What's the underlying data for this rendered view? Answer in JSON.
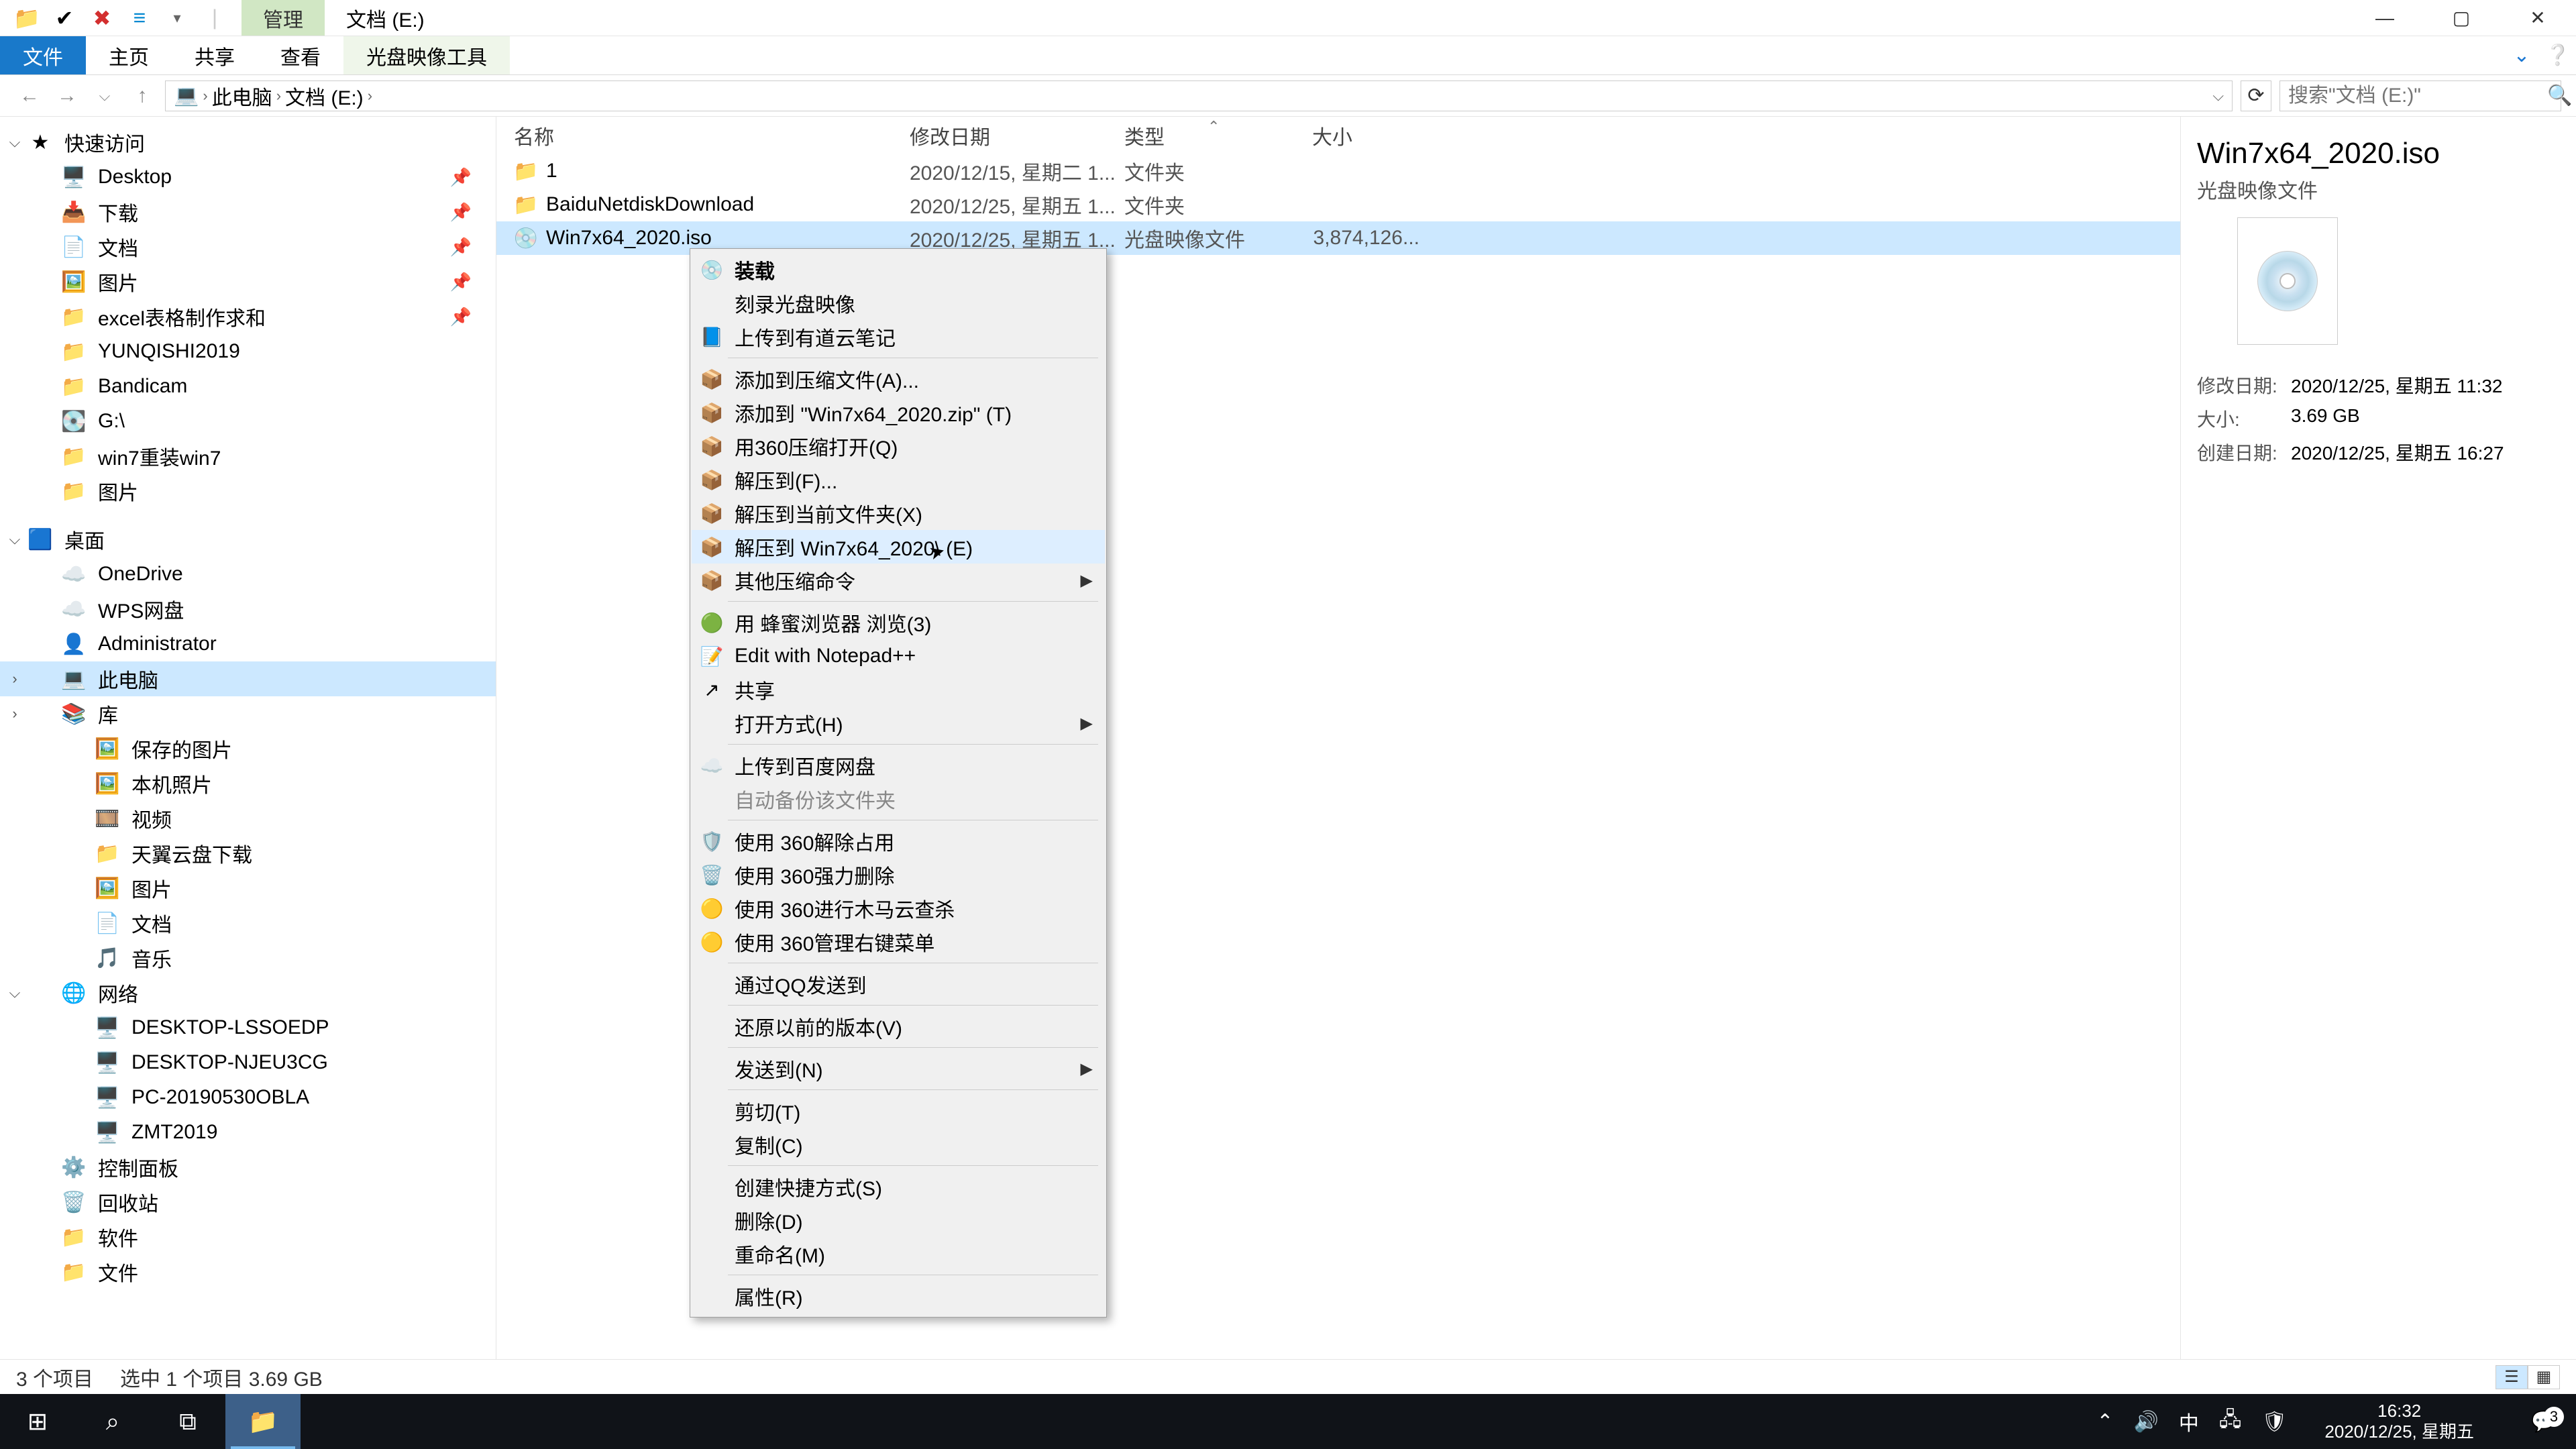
{
  "titlebar": {
    "context_tab": "管理",
    "location_tab": "文档 (E:)"
  },
  "ribbon": {
    "tabs": [
      "文件",
      "主页",
      "共享",
      "查看",
      "光盘映像工具"
    ]
  },
  "breadcrumb": {
    "segments": [
      "此电脑",
      "文档 (E:)"
    ]
  },
  "search": {
    "placeholder": "搜索\"文档 (E:)\""
  },
  "nav": {
    "quick_access": "快速访问",
    "items_qa": [
      {
        "label": "Desktop",
        "icon": "🖥️",
        "pin": true
      },
      {
        "label": "下载",
        "icon": "📥",
        "pin": true
      },
      {
        "label": "文档",
        "icon": "📄",
        "pin": true
      },
      {
        "label": "图片",
        "icon": "🖼️",
        "pin": true
      },
      {
        "label": "excel表格制作求和",
        "icon": "📁",
        "pin": true
      },
      {
        "label": "YUNQISHI2019",
        "icon": "📁",
        "pin": false
      },
      {
        "label": "Bandicam",
        "icon": "📁",
        "pin": false
      },
      {
        "label": "G:\\",
        "icon": "💽",
        "pin": false
      },
      {
        "label": "win7重装win7",
        "icon": "📁",
        "pin": false
      },
      {
        "label": "图片",
        "icon": "📁",
        "pin": false
      }
    ],
    "desktop": "桌面",
    "items_desktop": [
      {
        "label": "OneDrive",
        "icon": "☁️"
      },
      {
        "label": "WPS网盘",
        "icon": "☁️"
      },
      {
        "label": "Administrator",
        "icon": "👤"
      },
      {
        "label": "此电脑",
        "icon": "💻",
        "selected": true
      },
      {
        "label": "库",
        "icon": "📚"
      }
    ],
    "items_lib": [
      {
        "label": "保存的图片",
        "icon": "🖼️"
      },
      {
        "label": "本机照片",
        "icon": "🖼️"
      },
      {
        "label": "视频",
        "icon": "🎞️"
      },
      {
        "label": "天翼云盘下载",
        "icon": "📁"
      },
      {
        "label": "图片",
        "icon": "🖼️"
      },
      {
        "label": "文档",
        "icon": "📄"
      },
      {
        "label": "音乐",
        "icon": "🎵"
      }
    ],
    "network": "网络",
    "items_net": [
      {
        "label": "DESKTOP-LSSOEDP",
        "icon": "🖥️"
      },
      {
        "label": "DESKTOP-NJEU3CG",
        "icon": "🖥️"
      },
      {
        "label": "PC-20190530OBLA",
        "icon": "🖥️"
      },
      {
        "label": "ZMT2019",
        "icon": "🖥️"
      }
    ],
    "items_bottom": [
      {
        "label": "控制面板",
        "icon": "⚙️"
      },
      {
        "label": "回收站",
        "icon": "🗑️"
      },
      {
        "label": "软件",
        "icon": "📁"
      },
      {
        "label": "文件",
        "icon": "📁"
      }
    ]
  },
  "columns": {
    "name": "名称",
    "date": "修改日期",
    "type": "类型",
    "size": "大小"
  },
  "rows": [
    {
      "name": "1",
      "date": "2020/12/15, 星期二 1...",
      "type": "文件夹",
      "size": "",
      "icon": "📁",
      "cls": "folder-ico"
    },
    {
      "name": "BaiduNetdiskDownload",
      "date": "2020/12/25, 星期五 1...",
      "type": "文件夹",
      "size": "",
      "icon": "📁",
      "cls": "folder-ico"
    },
    {
      "name": "Win7x64_2020.iso",
      "date": "2020/12/25, 星期五 1...",
      "type": "光盘映像文件",
      "size": "3,874,126...",
      "icon": "💿",
      "cls": "iso-ico",
      "selected": true
    }
  ],
  "details": {
    "title": "Win7x64_2020.iso",
    "type": "光盘映像文件",
    "props": [
      {
        "k": "修改日期:",
        "v": "2020/12/25, 星期五 11:32"
      },
      {
        "k": "大小:",
        "v": "3.69 GB"
      },
      {
        "k": "创建日期:",
        "v": "2020/12/25, 星期五 16:27"
      }
    ]
  },
  "ctx": [
    {
      "label": "装载",
      "bold": true,
      "icon": "💿"
    },
    {
      "label": "刻录光盘映像"
    },
    {
      "label": "上传到有道云笔记",
      "icon": "📘",
      "icls": "blue-ico"
    },
    {
      "sep": true
    },
    {
      "label": "添加到压缩文件(A)...",
      "icon": "📦"
    },
    {
      "label": "添加到 \"Win7x64_2020.zip\" (T)",
      "icon": "📦"
    },
    {
      "label": "用360压缩打开(Q)",
      "icon": "📦"
    },
    {
      "label": "解压到(F)...",
      "icon": "📦"
    },
    {
      "label": "解压到当前文件夹(X)",
      "icon": "📦"
    },
    {
      "label": "解压到 Win7x64_2020\\ (E)",
      "icon": "📦",
      "hover": true
    },
    {
      "label": "其他压缩命令",
      "icon": "📦",
      "sub": true
    },
    {
      "sep": true
    },
    {
      "label": "用 蜂蜜浏览器 浏览(3)",
      "icon": "🟢",
      "icls": "green-ico"
    },
    {
      "label": "Edit with Notepad++",
      "icon": "📝"
    },
    {
      "label": "共享",
      "icon": "↗"
    },
    {
      "label": "打开方式(H)",
      "sub": true
    },
    {
      "sep": true
    },
    {
      "label": "上传到百度网盘",
      "icon": "☁️"
    },
    {
      "label": "自动备份该文件夹",
      "disabled": true
    },
    {
      "sep": true
    },
    {
      "label": "使用 360解除占用",
      "icon": "🛡️"
    },
    {
      "label": "使用 360强力删除",
      "icon": "🗑️"
    },
    {
      "label": "使用 360进行木马云查杀",
      "icon": "🟡"
    },
    {
      "label": "使用 360管理右键菜单",
      "icon": "🟡"
    },
    {
      "sep": true
    },
    {
      "label": "通过QQ发送到"
    },
    {
      "sep": true
    },
    {
      "label": "还原以前的版本(V)"
    },
    {
      "sep": true
    },
    {
      "label": "发送到(N)",
      "sub": true
    },
    {
      "sep": true
    },
    {
      "label": "剪切(T)"
    },
    {
      "label": "复制(C)"
    },
    {
      "sep": true
    },
    {
      "label": "创建快捷方式(S)"
    },
    {
      "label": "删除(D)"
    },
    {
      "label": "重命名(M)"
    },
    {
      "sep": true
    },
    {
      "label": "属性(R)"
    }
  ],
  "status": {
    "count": "3 个项目",
    "sel": "选中 1 个项目  3.69 GB"
  },
  "taskbar": {
    "time": "16:32",
    "date": "2020/12/25, 星期五",
    "notif_count": "3"
  }
}
